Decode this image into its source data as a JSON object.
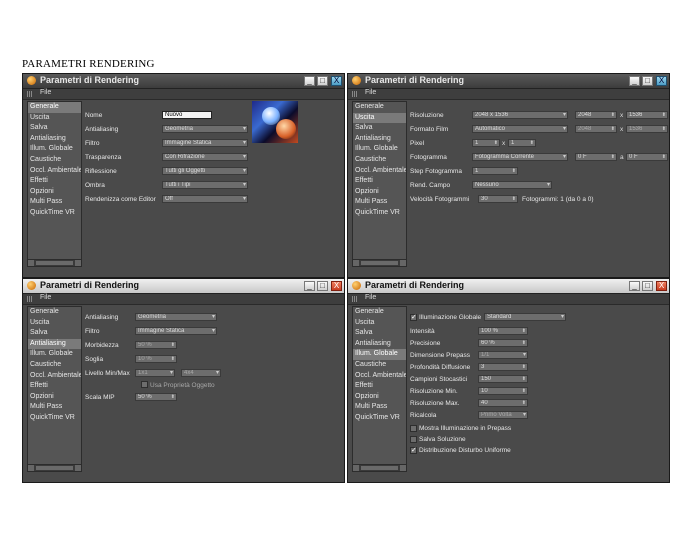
{
  "heading": "PARAMETRI RENDERING",
  "window_title": "Parametri di Rendering",
  "menu_file": "File",
  "win_buttons": {
    "minimize": "_",
    "maximize": "□",
    "close": "X"
  },
  "sidebar_items": [
    "Generale",
    "Uscita",
    "Salva",
    "Antialiasing",
    "Illum. Globale",
    "Caustiche",
    "Occl. Ambientale",
    "Effetti",
    "Opzioni",
    "Multi Pass",
    "QuickTime VR"
  ],
  "panel1": {
    "labels": {
      "nome": "Nome",
      "antialiasing": "Antialiasing",
      "filtro": "Filtro",
      "trasparenza": "Trasparenza",
      "riflessione": "Riflessione",
      "ombra": "Ombra",
      "rendi_editor": "Rendenizza come Editor"
    },
    "values": {
      "nome": "Nuovo",
      "antialiasing": "Geometria",
      "filtro": "Immagine Statica",
      "trasparenza": "Con Rifrazione",
      "riflessione": "Tutti gli Oggetti",
      "ombra": "Tutti i Tipi",
      "rendi_editor": "Off"
    }
  },
  "panel2": {
    "labels": {
      "risoluzione": "Risoluzione",
      "formato": "Formato Film",
      "pixel": "Pixel",
      "fotogramma": "Fotogramma",
      "step": "Step Fotogramma",
      "campi": "Rend. Campo",
      "velocita": "Velocità Fotogrammi"
    },
    "values": {
      "risoluzione": "2048 x 1536",
      "res_w": "2048",
      "res_h": "1536",
      "formato": "Automatico",
      "form_w": "2048",
      "form_h": "1536",
      "pixel_a": "1",
      "pixel_b": "1",
      "fotogramma": "Fotogramma Corrente",
      "fot_from": "0 F",
      "fot_to": "0 F",
      "step": "1",
      "campi": "Nessuno",
      "velocita": "30",
      "fotogrammi_info": "Fotogrammi: 1 (da 0 a 0)",
      "x_sep": "x",
      "a_sep": "a"
    }
  },
  "panel3": {
    "labels": {
      "antialiasing": "Antialiasing",
      "filtro": "Filtro",
      "morbidezza": "Morbidezza",
      "soglia": "Soglia",
      "livello": "Livello Min/Max",
      "usa_prop": "Usa Proprietà Oggetto",
      "scala_mip": "Scala MIP"
    },
    "values": {
      "antialiasing": "Geometria",
      "filtro": "Immagine Statica",
      "morbidezza": "50 %",
      "soglia": "10 %",
      "liv_min": "1x1",
      "liv_max": "4x4",
      "scala_mip": "50 %"
    }
  },
  "panel4": {
    "labels": {
      "illum": "Illuminazione Globale",
      "intensita": "Intensità",
      "precisione": "Precisione",
      "dim_prepass": "Dimensione Prepass",
      "prof_diff": "Profondità Diffusione",
      "campioni": "Campioni Stocastici",
      "ris_min": "Risoluzione Min.",
      "ris_max": "Risoluzione Max.",
      "ricalcola": "Ricalcola",
      "mostra": "Mostra Illuminazione in Prepass",
      "salva_sol": "Salva Soluzione",
      "distribuzione": "Distribuzione Disturbo Uniforme"
    },
    "values": {
      "illum": "Standard",
      "intensita": "100 %",
      "precisione": "60 %",
      "dim_prepass": "1/1",
      "prof_diff": "3",
      "campioni": "150",
      "ris_min": "10",
      "ris_max": "40",
      "ricalcola": "Primo Volta",
      "check_mark": "✓"
    }
  }
}
